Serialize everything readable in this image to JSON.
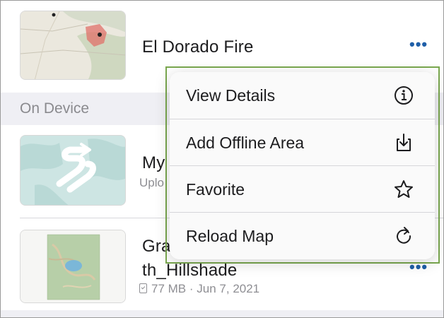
{
  "items": [
    {
      "title": "El Dorado Fire",
      "thumb_icon": "fire-map-thumbnail"
    },
    {
      "title": "My",
      "subtitle": "Uplo",
      "thumb_icon": "offline-map-placeholder-thumbnail"
    },
    {
      "title_line1": "Gra",
      "title_line2": "th_Hillshade",
      "size": "77 MB",
      "separator": "·",
      "date": "Jun 7, 2021",
      "thumb_icon": "hillshade-map-thumbnail"
    }
  ],
  "section": {
    "label": "On Device"
  },
  "more_label": "•••",
  "menu": {
    "items": [
      {
        "label": "View Details",
        "icon": "info-circle-icon"
      },
      {
        "label": "Add Offline Area",
        "icon": "download-tray-icon"
      },
      {
        "label": "Favorite",
        "icon": "star-icon"
      },
      {
        "label": "Reload Map",
        "icon": "reload-icon"
      }
    ]
  },
  "colors": {
    "accent": "#1f5fa8",
    "highlight": "#7aa84f",
    "section_bg": "#efeff4",
    "fire": "#e05a50"
  }
}
